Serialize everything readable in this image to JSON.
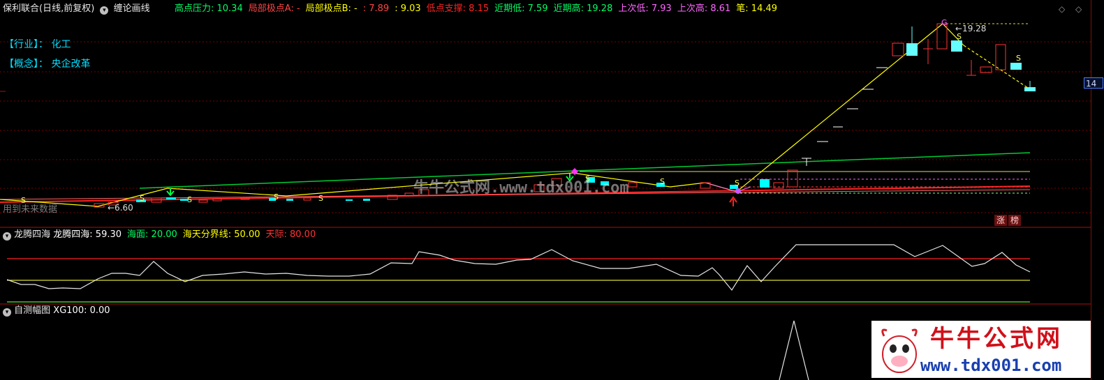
{
  "header": {
    "stock_name": "保利联合(日线,前复权)",
    "indicator_name": "缠论画线",
    "items": [
      {
        "label": "高点压力",
        "value": "10.34",
        "color": "#00ff66"
      },
      {
        "label": "局部极点A",
        "value": "-",
        "color": "#ff4444"
      },
      {
        "label": "局部极点B",
        "value": "-",
        "color": "#ffff00"
      },
      {
        "label": "",
        "value": "7.89",
        "color": "#ff4444"
      },
      {
        "label": "",
        "value": "9.03",
        "color": "#ffff00"
      },
      {
        "label": "低点支撑",
        "value": "8.15",
        "color": "#ff2222"
      },
      {
        "label": "近期低",
        "value": "7.59",
        "color": "#00ff66"
      },
      {
        "label": "近期高",
        "value": "19.28",
        "color": "#00ff66"
      },
      {
        "label": "上次低",
        "value": "7.93",
        "color": "#ff66ff"
      },
      {
        "label": "上次高",
        "value": "8.61",
        "color": "#ff66ff"
      },
      {
        "label": "笔",
        "value": "14.49",
        "color": "#ffff00"
      }
    ]
  },
  "info": {
    "industry_label": "【行业】：",
    "industry_value": "化工",
    "concept_label": "【概念】：",
    "concept_value": "央企改革"
  },
  "main_chart": {
    "price_labels": {
      "high": "19.28",
      "low": "6.60"
    },
    "future_data_text": "用到未来数据",
    "watermark": "牛牛公式网.www.tdx001.com",
    "current_price_tag": "14",
    "badges": [
      "涨",
      "榜"
    ]
  },
  "indicator1": {
    "title": "龙腾四海",
    "items": [
      {
        "label": "龙腾四海",
        "value": "59.30",
        "color": "#ffffff"
      },
      {
        "label": "海面",
        "value": "20.00",
        "color": "#00ff66"
      },
      {
        "label": "海天分界线",
        "value": "50.00",
        "color": "#ffff00"
      },
      {
        "label": "天际",
        "value": "80.00",
        "color": "#ff3333"
      }
    ]
  },
  "indicator2": {
    "title": "自测幅图",
    "items": [
      {
        "label": "XG100",
        "value": "0.00",
        "color": "#ffffff"
      }
    ]
  },
  "logo": {
    "title": "牛牛公式网",
    "url": "www.tdx001.com"
  },
  "window_buttons": [
    "◇",
    "◇"
  ]
}
